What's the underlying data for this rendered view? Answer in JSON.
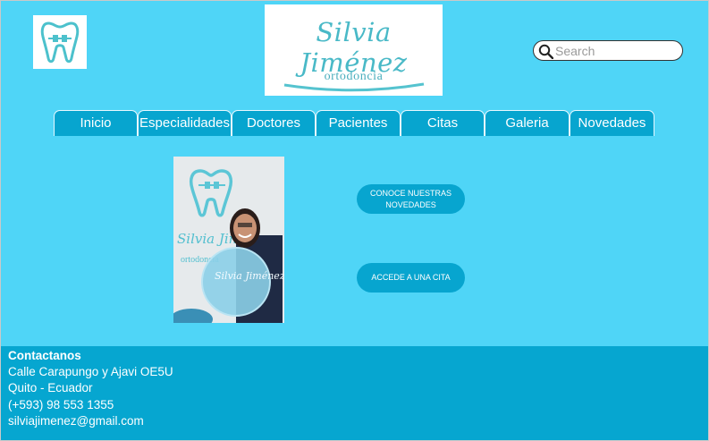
{
  "header": {
    "brand_name": "Silvia Jiménez",
    "brand_subtitle": "ortodoncia",
    "logo_icon": "tooth-braces-icon",
    "search_placeholder": "Search"
  },
  "nav": {
    "tabs": [
      {
        "label": "Inicio"
      },
      {
        "label": "Especialidades"
      },
      {
        "label": "Doctores"
      },
      {
        "label": "Pacientes"
      },
      {
        "label": "Citas"
      },
      {
        "label": "Galeria"
      },
      {
        "label": "Novedades"
      }
    ]
  },
  "main": {
    "photo_brand_name": "Silvia Jiménez",
    "photo_brand_subtitle": "ortodoncia",
    "cta_news": "CONOCE NUESTRAS NOVEDADES",
    "cta_appointment": "ACCEDE A UNA CITA"
  },
  "footer": {
    "heading": "Contactanos",
    "address": "Calle Carapungo y Ajavi OE5U",
    "city": "Quito - Ecuador",
    "phone": "(+593) 98 553 1355",
    "email": "silviajimenez@gmail.com"
  },
  "colors": {
    "background": "#4fd5f7",
    "accent": "#07a5cf",
    "brand_teal": "#49b9c7"
  }
}
